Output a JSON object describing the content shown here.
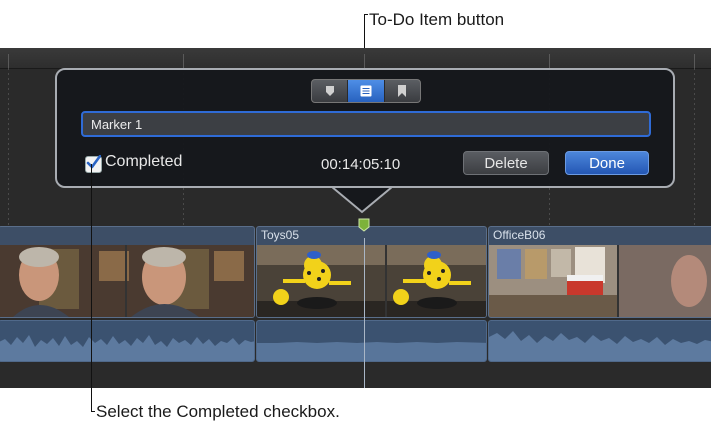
{
  "callouts": {
    "todo_button": "To-Do Item button",
    "completed_checkbox": "Select the Completed checkbox."
  },
  "popover": {
    "marker_types": [
      {
        "name": "standard-marker",
        "icon": "marker-icon",
        "active": false
      },
      {
        "name": "todo-item",
        "icon": "todo-list-icon",
        "active": true
      },
      {
        "name": "chapter-marker",
        "icon": "bookmark-icon",
        "active": false
      }
    ],
    "marker_name_value": "Marker 1",
    "completed_label": "Completed",
    "completed_checked": true,
    "timecode": "00:14:05:10",
    "delete_label": "Delete",
    "done_label": "Done"
  },
  "timeline": {
    "clips": [
      {
        "name": "",
        "thumb": "man-talking"
      },
      {
        "name": "Toys05",
        "thumb": "yellow-toy-robot"
      },
      {
        "name": "OfficeB06",
        "thumb": "office-clapperboard"
      }
    ]
  },
  "colors": {
    "accent_blue": "#2f6bd6",
    "marker_green": "#7db23a",
    "clip_blue": "#3d4e66"
  }
}
